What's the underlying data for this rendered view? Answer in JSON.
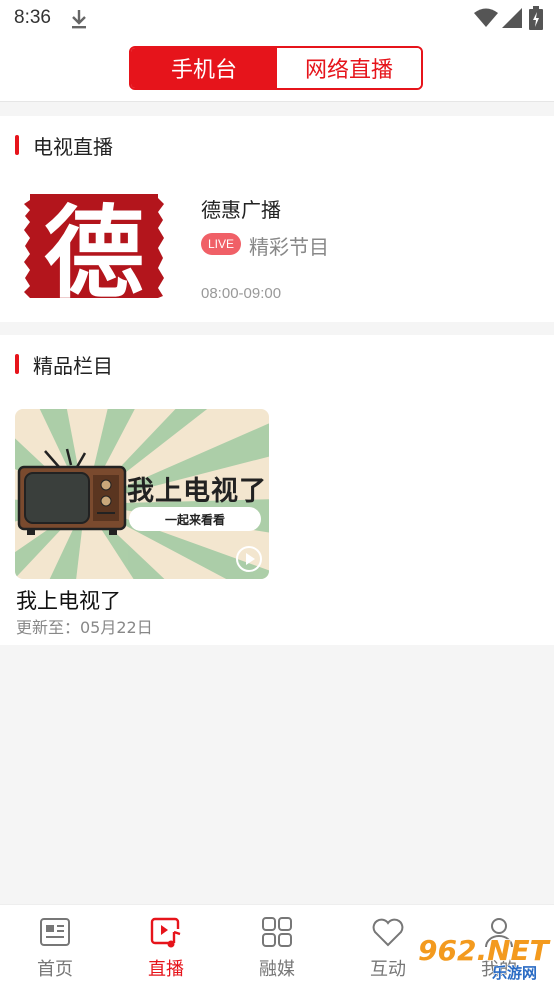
{
  "status_bar": {
    "time": "8:36"
  },
  "header": {
    "tabs": [
      {
        "label": "手机台",
        "active": true
      },
      {
        "label": "网络直播",
        "active": false
      }
    ]
  },
  "tv_section": {
    "title": "电视直播",
    "channel": {
      "logo_char": "德",
      "name": "德惠广播",
      "live_badge": "LIVE",
      "program": "精彩节目",
      "time": "08:00-09:00"
    }
  },
  "programs_section": {
    "title": "精品栏目",
    "items": [
      {
        "thumb_title": "我上电视了",
        "thumb_subtitle": "一起来看看",
        "title": "我上电视了",
        "update": "更新至：05月22日"
      }
    ]
  },
  "bottom_nav": {
    "items": [
      {
        "label": "首页",
        "icon": "news-icon",
        "active": false
      },
      {
        "label": "直播",
        "icon": "live-video-icon",
        "active": true
      },
      {
        "label": "融媒",
        "icon": "grid-icon",
        "active": false
      },
      {
        "label": "互动",
        "icon": "heart-icon",
        "active": false
      },
      {
        "label": "我的",
        "icon": "user-icon",
        "active": false
      }
    ]
  },
  "watermark": {
    "text": "962.NET",
    "subtext": "乐游网"
  },
  "colors": {
    "accent": "#e6141b",
    "background": "#f5f5f5"
  }
}
